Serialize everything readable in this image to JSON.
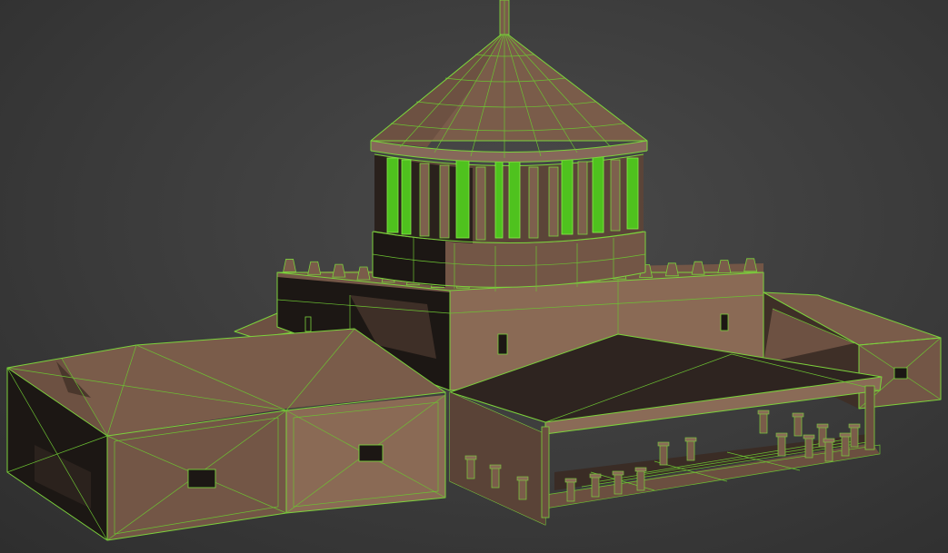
{
  "scene": {
    "background_color": "#3b3b3b",
    "model_fill_color": "#7a5c4a",
    "wireframe_color": "#7cd23c",
    "selected_color": "#4fc21e",
    "subject": "mausoleum-3d-model"
  }
}
